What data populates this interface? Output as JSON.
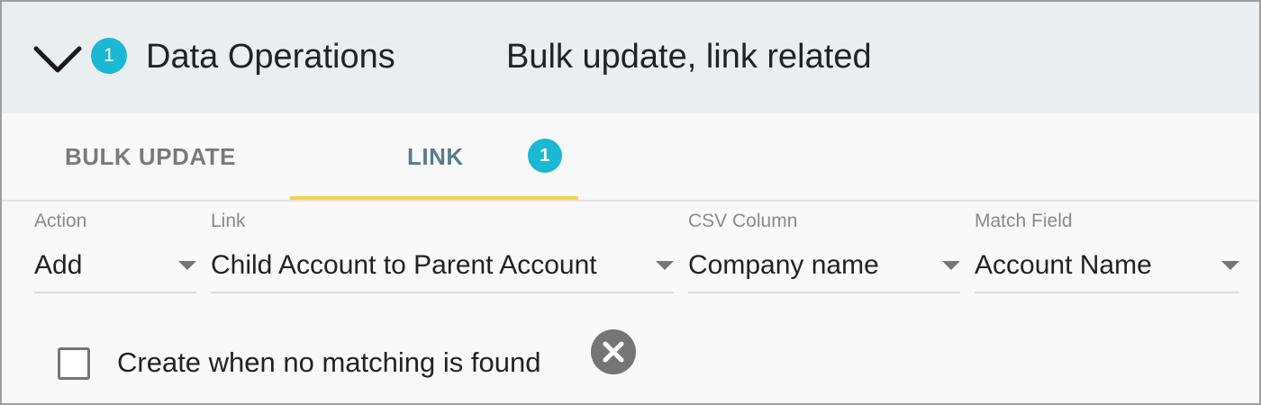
{
  "header": {
    "section_title": "Data Operations",
    "summary": "Bulk update, link related",
    "badge_count": "1",
    "expand_icon": "chevron-down-icon"
  },
  "tabs": [
    {
      "label": "BULK UPDATE",
      "active": false
    },
    {
      "label": "LINK",
      "active": true,
      "badge": "1"
    }
  ],
  "fields": {
    "action": {
      "label": "Action",
      "value": "Add"
    },
    "link": {
      "label": "Link",
      "value": "Child Account to Parent Account"
    },
    "csv_column": {
      "label": "CSV Column",
      "value": "Company name"
    },
    "match_field": {
      "label": "Match Field",
      "value": "Account Name"
    }
  },
  "create_option": {
    "label": "Create when no matching is found",
    "checked": false
  },
  "remove_icon": "close-circle-icon",
  "colors": {
    "badge": "#1ab8d2",
    "active_tab_text": "#5b7b8d",
    "active_tab_indicator": "#f6d44a",
    "header_bg": "#eaeef1"
  }
}
